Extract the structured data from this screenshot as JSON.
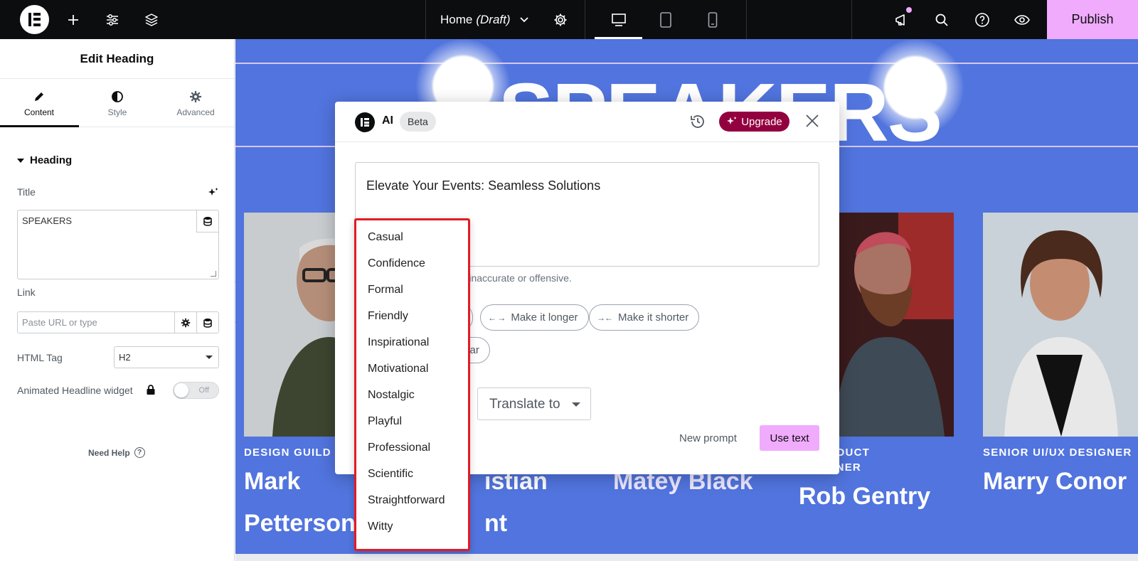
{
  "topbar": {
    "page_title": "Home",
    "page_status": "(Draft)",
    "publish_label": "Publish"
  },
  "panel": {
    "header": "Edit Heading",
    "tabs": [
      {
        "label": "Content",
        "icon": "pencil-icon",
        "active": true
      },
      {
        "label": "Style",
        "icon": "contrast-icon",
        "active": false
      },
      {
        "label": "Advanced",
        "icon": "gear-icon",
        "active": false
      }
    ],
    "section_title": "Heading",
    "title_label": "Title",
    "title_value": "SPEAKERS",
    "link_label": "Link",
    "link_placeholder": "Paste URL or type",
    "html_tag_label": "HTML Tag",
    "html_tag_value": "H2",
    "animated_label": "Animated Headline widget",
    "toggle_state": "Off",
    "need_help": "Need Help"
  },
  "canvas": {
    "heading": "SPEAKERS",
    "speakers": [
      {
        "role": "DESIGN GUILD",
        "name_line1": "Mark",
        "name_line2": "Petterson"
      },
      {
        "role": "",
        "name_line1": "istian",
        "name_line2": "nt"
      },
      {
        "role": "",
        "name_line1": "Matey Black",
        "name_line2": ""
      },
      {
        "role_line1": "R PRODUCT",
        "role_line2": "DESIGNER",
        "name_line1": "Rob Gentry"
      },
      {
        "role": "SENIOR UI/UX DESIGNER",
        "name_line1": "Marry Conor"
      }
    ],
    "colors": {
      "background": "#5174de",
      "accent_line": "#d7c6f2"
    }
  },
  "ai_modal": {
    "brand": "AI",
    "badge": "Beta",
    "upgrade_label": "Upgrade",
    "generated_text": "Elevate Your Events: Seamless Solutions",
    "disclaimer": "y be inaccurate or offensive.",
    "chips": {
      "longer": "Make it longer",
      "shorter": "Make it shorter",
      "grammar_partial": "mar"
    },
    "translate_label": "Translate to",
    "new_prompt_label": "New prompt",
    "use_text_label": "Use text",
    "colors": {
      "upgrade": "#93003f",
      "primary_button": "#f0abfc"
    }
  },
  "tone_dropdown": {
    "options": [
      "Casual",
      "Confidence",
      "Formal",
      "Friendly",
      "Inspirational",
      "Motivational",
      "Nostalgic",
      "Playful",
      "Professional",
      "Scientific",
      "Straightforward",
      "Witty"
    ],
    "highlight_color": "#e31b23"
  }
}
